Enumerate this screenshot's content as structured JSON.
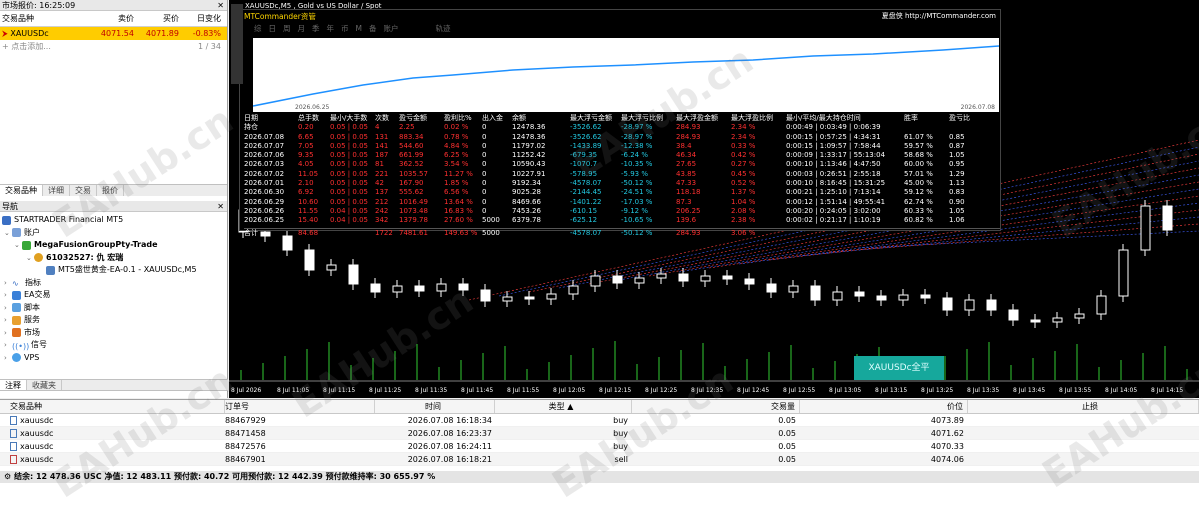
{
  "market_watch": {
    "title": "市场报价: 16:25:09",
    "headers": {
      "symbol": "交易品种",
      "bid": "卖价",
      "ask": "买价",
      "change": "日变化"
    },
    "row": {
      "symbol": "XAUUSDc",
      "bid": "4071.54",
      "ask": "4071.89",
      "change": "-0.83%"
    },
    "add_label": "点击添加...",
    "count": "1 / 34",
    "tabs": [
      "交易品种",
      "详细",
      "交易",
      "报价"
    ]
  },
  "navigator": {
    "title": "导航",
    "broker": "STARTRADER Financial MT5",
    "accounts_label": "账户",
    "server": "MegaFusionGroupPty-Trade",
    "account": "61032527: 仇 宏瑞",
    "ea": "MT5盛世黄金-EA-0.1 - XAUUSDc,M5",
    "items": [
      "指标",
      "EA交易",
      "脚本",
      "服务",
      "市场",
      "信号",
      "VPS"
    ],
    "tabs": [
      "注释",
      "收藏夹"
    ]
  },
  "chart": {
    "title": "XAUUSDc,M5 , Gold vs US Dollar / Spot",
    "ea_button": "XAUUSDc全平",
    "x_labels": [
      "8 Jul 2026",
      "8 Jul 11:05",
      "8 Jul 11:15",
      "8 Jul 11:25",
      "8 Jul 11:35",
      "8 Jul 11:45",
      "8 Jul 11:55",
      "8 Jul 12:05",
      "8 Jul 12:15",
      "8 Jul 12:25",
      "8 Jul 12:35",
      "8 Jul 12:45",
      "8 Jul 12:55",
      "8 Jul 13:05",
      "8 Jul 13:15",
      "8 Jul 13:25",
      "8 Jul 13:35",
      "8 Jul 13:45",
      "8 Jul 13:55",
      "8 Jul 14:05",
      "8 Jul 14:15"
    ]
  },
  "stats_panel": {
    "title": "MTCommander资管",
    "link": "夏盘侠 http://MTCommander.com",
    "tabs": [
      "综",
      "日",
      "周",
      "月",
      "季",
      "年",
      "币",
      "M",
      "备",
      "账户",
      "轨迹"
    ],
    "graph_start": "2026.06.25",
    "graph_end": "2026.07.08",
    "headers": [
      "日期",
      "总手数",
      "最小/大手数",
      "次数",
      "盈亏金额",
      "盈利比%",
      "出入金",
      "余额",
      "最大浮亏金额",
      "最大浮亏比例",
      "最大浮盈金额",
      "最大浮盈比例",
      "最小/平均/最大持仓时间",
      "胜率",
      "盈亏比"
    ],
    "rows": [
      [
        "持仓",
        "0.20",
        "0.05 | 0.05",
        "4",
        "2.25",
        "0.02 %",
        "0",
        "12478.36",
        "-3526.62",
        "-28.97 %",
        "284.93",
        "2.34 %",
        "0:00:49 | 0:03:49 | 0:06:39",
        "",
        ""
      ],
      [
        "2026.07.08",
        "6.65",
        "0.05 | 0.05",
        "131",
        "883.34",
        "0.78 %",
        "0",
        "12478.36",
        "-3526.62",
        "-28.97 %",
        "284.93",
        "2.34 %",
        "0:00:15 | 0:57:25 | 4:34:31",
        "61.07 %",
        "0.85"
      ],
      [
        "2026.07.07",
        "7.05",
        "0.05 | 0.05",
        "141",
        "544.60",
        "4.84 %",
        "0",
        "11797.02",
        "-1433.89",
        "-12.38 %",
        "38.4",
        "0.33 %",
        "0:00:15 | 1:09:57 | 7:58:44",
        "59.57 %",
        "0.87"
      ],
      [
        "2026.07.06",
        "9.35",
        "0.05 | 0.05",
        "187",
        "661.99",
        "6.25 %",
        "0",
        "11252.42",
        "-679.35",
        "-6.24 %",
        "46.34",
        "0.42 %",
        "0:00:09 | 1:33:17 | 55:13:04",
        "58.68 %",
        "1.05"
      ],
      [
        "2026.07.03",
        "4.05",
        "0.05 | 0.05",
        "81",
        "362.52",
        "3.54 %",
        "0",
        "10590.43",
        "-1070.7",
        "-10.35 %",
        "27.65",
        "0.27 %",
        "0:00:10 | 1:13:46 | 4:47:50",
        "60.00 %",
        "0.95"
      ],
      [
        "2026.07.02",
        "11.05",
        "0.05 | 0.05",
        "221",
        "1035.57",
        "11.27 %",
        "0",
        "10227.91",
        "-578.95",
        "-5.93 %",
        "43.85",
        "0.45 %",
        "0:00:03 | 0:26:51 | 2:55:18",
        "57.01 %",
        "1.29"
      ],
      [
        "2026.07.01",
        "2.10",
        "0.05 | 0.05",
        "42",
        "167.90",
        "1.85 %",
        "0",
        "9192.34",
        "-4578.07",
        "-50.12 %",
        "47.33",
        "0.52 %",
        "0:00:10 | 8:16:45 | 15:31:25",
        "45.00 %",
        "1.13"
      ],
      [
        "2026.06.30",
        "6.92",
        "0.05 | 0.05",
        "137",
        "555.62",
        "6.56 %",
        "0",
        "9025.28",
        "-2144.45",
        "-24.51 %",
        "118.18",
        "1.37 %",
        "0:00:21 | 1:25:10 | 7:13:14",
        "59.12 %",
        "0.83"
      ],
      [
        "2026.06.29",
        "10.60",
        "0.05 | 0.05",
        "212",
        "1016.49",
        "13.64 %",
        "0",
        "8469.66",
        "-1401.22",
        "-17.03 %",
        "87.3",
        "1.04 %",
        "0:00:12 | 1:51:14 | 49:55:41",
        "62.74 %",
        "0.90"
      ],
      [
        "2026.06.26",
        "11.55",
        "0.04 | 0.05",
        "242",
        "1073.48",
        "16.83 %",
        "0",
        "7453.26",
        "-610.15",
        "-9.12 %",
        "206.25",
        "2.08 %",
        "0:00:20 | 0:24:05 | 3:02:00",
        "60.33 %",
        "1.05"
      ],
      [
        "2026.06.25",
        "15.40",
        "0.04 | 0.05",
        "342",
        "1379.78",
        "27.60 %",
        "5000",
        "6379.78",
        "-625.12",
        "-10.65 %",
        "139.6",
        "2.38 %",
        "0:00:02 | 0:21:17 | 1:10:19",
        "60.82 %",
        "1.06"
      ]
    ],
    "total": [
      "合计",
      "84.68",
      "",
      "1722",
      "7481.61",
      "149.63 %",
      "5000",
      "",
      "-4578.07",
      "-50.12 %",
      "284.93",
      "3.06 %",
      "",
      "",
      ""
    ]
  },
  "trades": {
    "headers": [
      "交易品种",
      "订单号",
      "时间",
      "类型",
      "交易量",
      "价位",
      "止损"
    ],
    "rows": [
      {
        "symbol": "xauusdc",
        "order": "88467929",
        "time": "2026.07.08 16:18:34",
        "type": "buy",
        "volume": "0.05",
        "price": "4073.89"
      },
      {
        "symbol": "xauusdc",
        "order": "88471458",
        "time": "2026.07.08 16:23:37",
        "type": "buy",
        "volume": "0.05",
        "price": "4071.62"
      },
      {
        "symbol": "xauusdc",
        "order": "88472576",
        "time": "2026.07.08 16:24:11",
        "type": "buy",
        "volume": "0.05",
        "price": "4070.33"
      },
      {
        "symbol": "xauusdc",
        "order": "88467901",
        "time": "2026.07.08 16:18:21",
        "type": "sell",
        "volume": "0.05",
        "price": "4074.06"
      }
    ],
    "summary": "结余: 12 478.36 USC  净值: 12 483.11  预付款: 40.72  可用预付款: 12 442.39  预付款维持率: 30 655.97 %"
  },
  "watermark": "EAHub.cn",
  "colors": {
    "accent": "#ffcc00",
    "loss": "#ff3030",
    "blue_line": "#1e90ff",
    "ea_button": "#16a89c"
  }
}
